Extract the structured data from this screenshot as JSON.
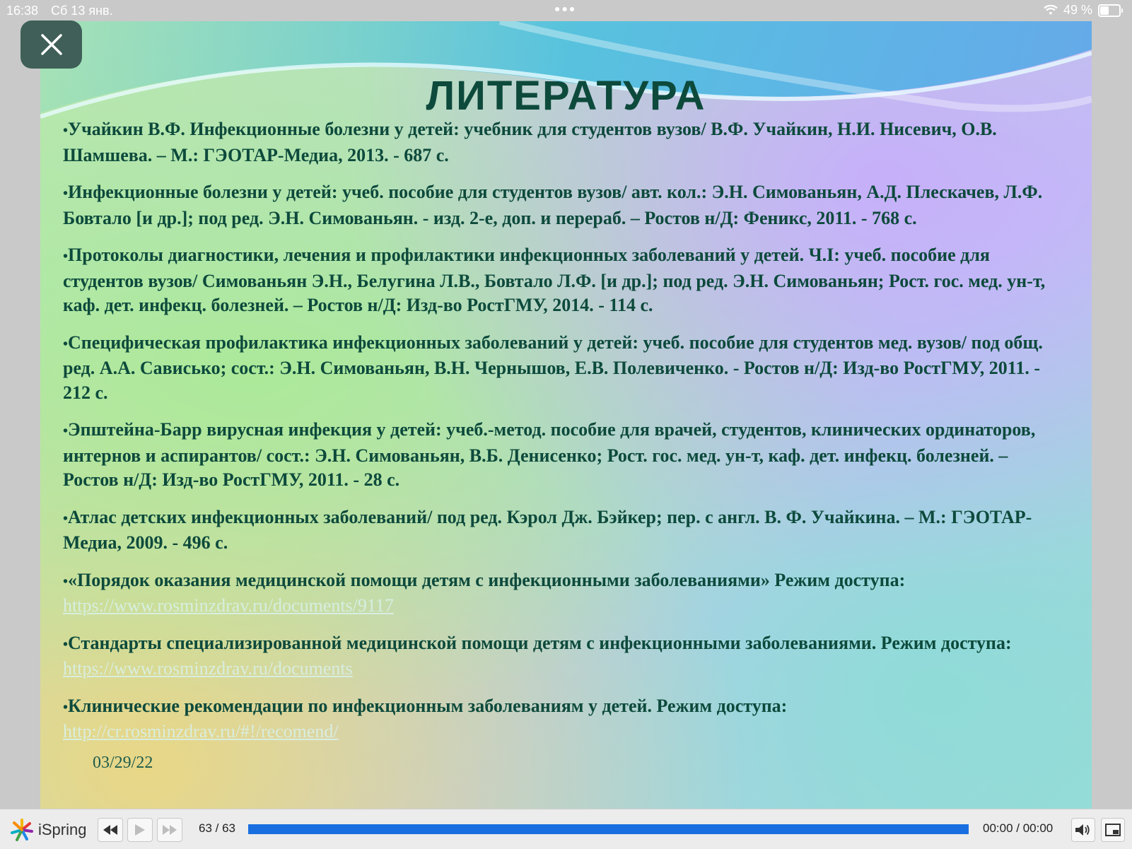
{
  "status": {
    "time": "16:38",
    "date": "Сб 13 янв.",
    "battery": "49 %",
    "battery_level": 0.49
  },
  "slide": {
    "title": "ЛИТЕРАТУРА",
    "refs": [
      "Учайкин В.Ф. Инфекционные болезни у детей: учебник для студентов вузов/ В.Ф. Учайкин, Н.И. Нисевич, О.В. Шамшева. – М.: ГЭОТАР-Медиа, 2013. - 687 с.",
      "Инфекционные болезни у детей: учеб.  пособие для студентов вузов/ авт. кол.: Э.Н. Симованьян, А.Д. Плескачев, Л.Ф. Бовтало [и др.]; под ред. Э.Н. Симованьян. - изд. 2-е, доп. и перераб. – Ростов н/Д: Феникс, 2011. - 768 с.",
      "Протоколы диагностики, лечения и профилактики инфекционных заболеваний у детей. Ч.I: учеб. пособие для студентов вузов/ Симованьян Э.Н., Белугина Л.В., Бовтало Л.Ф. [и др.]; под ред. Э.Н. Симованьян; Рост. гос. мед. ун-т, каф. дет. инфекц. болезней. – Ростов н/Д: Изд-во РостГМУ, 2014. - 114 с.",
      "Специфическая профилактика инфекционных заболеваний у детей: учеб. пособие для студентов мед. вузов/ под общ. ред. А.А. Савиcько; сост.: Э.Н. Симованьян, В.Н. Чернышов, Е.В. Полевиченко. - Ростов н/Д: Изд-во РостГМУ, 2011. - 212 с.",
      "Эпштейна-Барр вирусная инфекция у детей: учеб.-метод. пособие для врачей, студентов, клинических ординаторов, интернов и аспирантов/ сост.: Э.Н. Симованьян, В.Б. Денисенко; Рост. гос. мед. ун-т, каф. дет. инфекц. болезней. – Ростов н/Д: Изд-во РостГМУ, 2011. - 28 с.",
      "Атлас детских инфекционных заболеваний/ под ред. Кэрол Дж. Бэйкер; пер. с англ. В. Ф. Учайкина. – М.: ГЭОТАР-Медиа, 2009. - 496 с."
    ],
    "ref7_text": "«Порядок оказания медицинской помощи детям с инфекционными заболеваниями» Режим доступа:",
    "ref7_link": "https://www.rosminzdrav.ru/documents/9117",
    "ref8_text": "Стандарты специализированной медицинской помощи детям с инфекционными заболеваниями. Режим доступа:",
    "ref8_link": "https://www.rosminzdrav.ru/documents",
    "ref9_text": "Клинические рекомендации по инфекционным заболеваниям у детей. Режим доступа:",
    "ref9_link": "http://cr.rosminzdrav.ru/#!/recomend/",
    "date": "03/29/22"
  },
  "player": {
    "brand": "iSpring",
    "counter": "63 / 63",
    "timecode": "00:00 / 00:00",
    "progress": 1.0
  },
  "icons": {
    "close": "close-icon",
    "prev": "rewind-icon",
    "play": "play-icon",
    "next": "fast-forward-icon",
    "volume": "volume-icon",
    "fullscreen": "fullscreen-icon",
    "wifi": "wifi-icon",
    "battery": "battery-icon"
  },
  "colors": {
    "title": "#0d4a3c",
    "progress": "#1a6fe0",
    "close_bg": "#3f5f58"
  }
}
